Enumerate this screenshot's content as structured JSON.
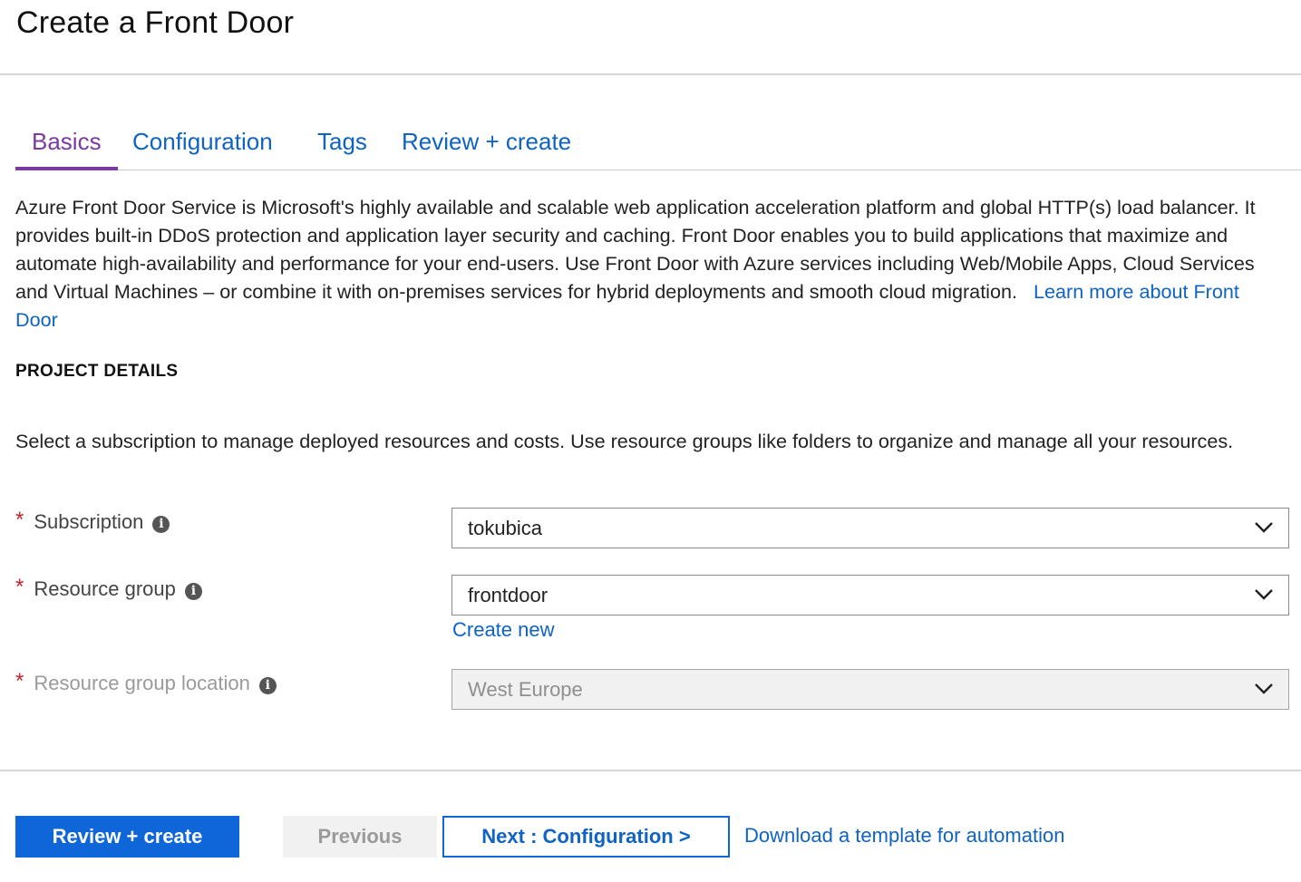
{
  "page": {
    "title": "Create a Front Door"
  },
  "tabs": [
    {
      "label": "Basics",
      "active": true
    },
    {
      "label": "Configuration",
      "active": false
    },
    {
      "label": "Tags",
      "active": false
    },
    {
      "label": "Review + create",
      "active": false
    }
  ],
  "intro": {
    "text": "Azure Front Door Service is Microsoft's highly available and scalable web application acceleration platform and global HTTP(s) load balancer. It provides built-in DDoS protection and application layer security and caching. Front Door enables you to build applications that maximize and automate high-availability and performance for your end-users. Use Front Door with Azure services including Web/Mobile Apps, Cloud Services and Virtual Machines – or combine it with on-premises services for hybrid deployments and smooth cloud migration.",
    "learn_more_label": "Learn more about Front Door"
  },
  "project_details": {
    "heading": "PROJECT DETAILS",
    "description": "Select a subscription to manage deployed resources and costs. Use resource groups like folders to organize and manage all your resources.",
    "fields": {
      "subscription": {
        "label": "Subscription",
        "value": "tokubica",
        "required": "*",
        "icon": "info-icon"
      },
      "resource_group": {
        "label": "Resource group",
        "value": "frontdoor",
        "required": "*",
        "icon": "info-icon",
        "create_new_label": "Create new"
      },
      "location": {
        "label": "Resource group location",
        "value": "West Europe",
        "required": "*",
        "icon": "info-icon",
        "disabled": true
      }
    }
  },
  "footer": {
    "review_create_label": "Review + create",
    "previous_label": "Previous",
    "next_label": "Next : Configuration >",
    "download_label": "Download a template for automation"
  },
  "colors": {
    "accent": "#0f66d8",
    "link": "#0f63c2",
    "active_tab": "#7a3ba0",
    "required": "#c4262e"
  }
}
